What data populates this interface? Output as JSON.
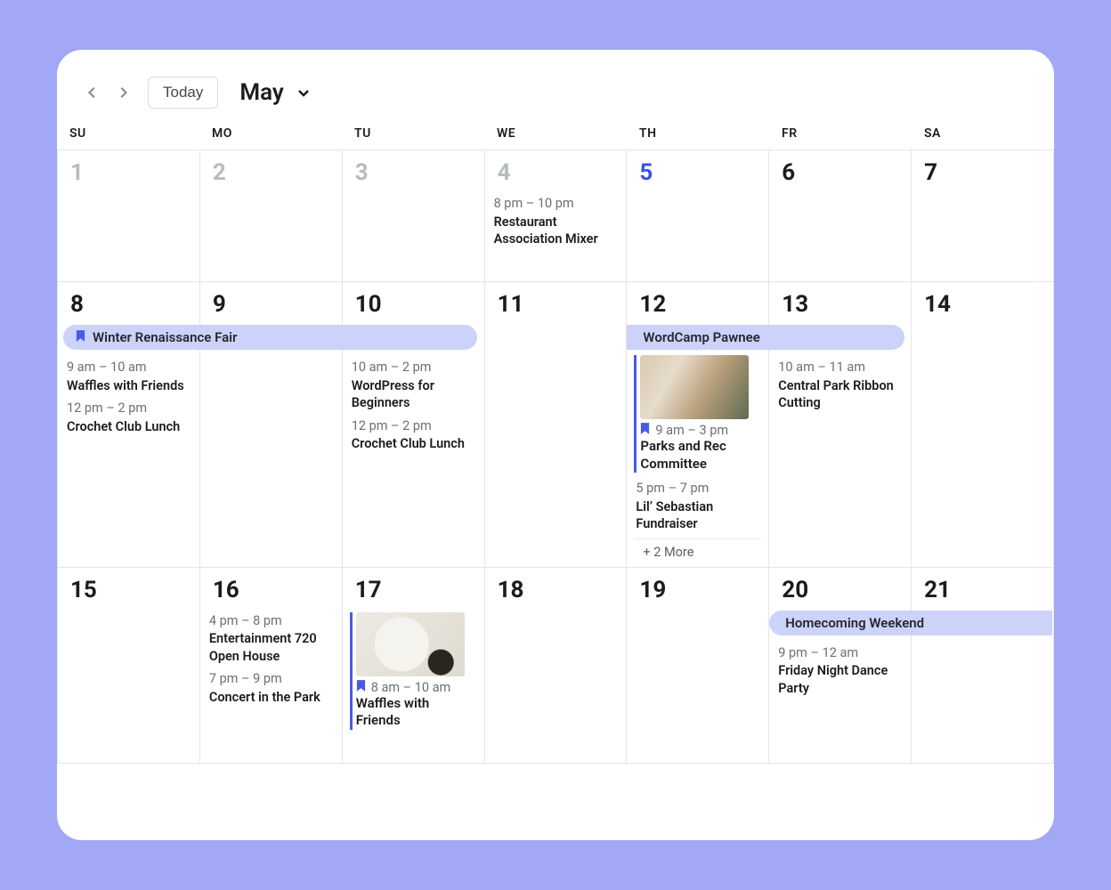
{
  "toolbar": {
    "today_label": "Today",
    "month_label": "May"
  },
  "dow": [
    "SU",
    "MO",
    "TU",
    "WE",
    "TH",
    "FR",
    "SA"
  ],
  "cells": {
    "d1": {
      "num": "1",
      "faded": true
    },
    "d2": {
      "num": "2",
      "faded": true
    },
    "d3": {
      "num": "3",
      "faded": true
    },
    "d4": {
      "num": "4",
      "faded": true,
      "e1_time": "8 pm – 10 pm",
      "e1_title": "Restaurant Association Mixer"
    },
    "d5": {
      "num": "5",
      "today": true
    },
    "d6": {
      "num": "6"
    },
    "d7": {
      "num": "7"
    },
    "d8": {
      "num": "8",
      "e1_time": "9 am – 10 am",
      "e1_title": "Waffles with Friends",
      "e2_time": "12 pm – 2 pm",
      "e2_title": "Crochet Club Lunch"
    },
    "d9": {
      "num": "9"
    },
    "d10": {
      "num": "10",
      "e1_time": "10 am – 2 pm",
      "e1_title": "WordPress for Beginners",
      "e2_time": "12 pm – 2 pm",
      "e2_title": "Crochet Club Lunch"
    },
    "d11": {
      "num": "11"
    },
    "d12": {
      "num": "12",
      "e1_time": "9 am – 3 pm",
      "e1_title": "Parks and Rec Committee",
      "e2_time": "5 pm – 7 pm",
      "e2_title": "Lil’ Sebastian Fundraiser",
      "more": "+ 2 More"
    },
    "d13": {
      "num": "13",
      "e1_time": "10 am – 11 am",
      "e1_title": "Central Park Ribbon Cutting"
    },
    "d14": {
      "num": "14"
    },
    "d15": {
      "num": "15"
    },
    "d16": {
      "num": "16",
      "e1_time": "4 pm – 8 pm",
      "e1_title": "Entertainment 720 Open House",
      "e2_time": "7 pm – 9 pm",
      "e2_title": "Concert in the Park"
    },
    "d17": {
      "num": "17",
      "e1_time": "8 am – 10 am",
      "e1_title": "Waffles with Friends"
    },
    "d18": {
      "num": "18"
    },
    "d19": {
      "num": "19"
    },
    "d20": {
      "num": "20",
      "e1_time": "9 pm – 12 am",
      "e1_title": "Friday Night Dance Party"
    },
    "d21": {
      "num": "21"
    }
  },
  "spans": {
    "winter": "Winter Renaissance Fair",
    "wordcamp": "WordCamp Pawnee",
    "homecoming": "Homecoming Weekend"
  }
}
